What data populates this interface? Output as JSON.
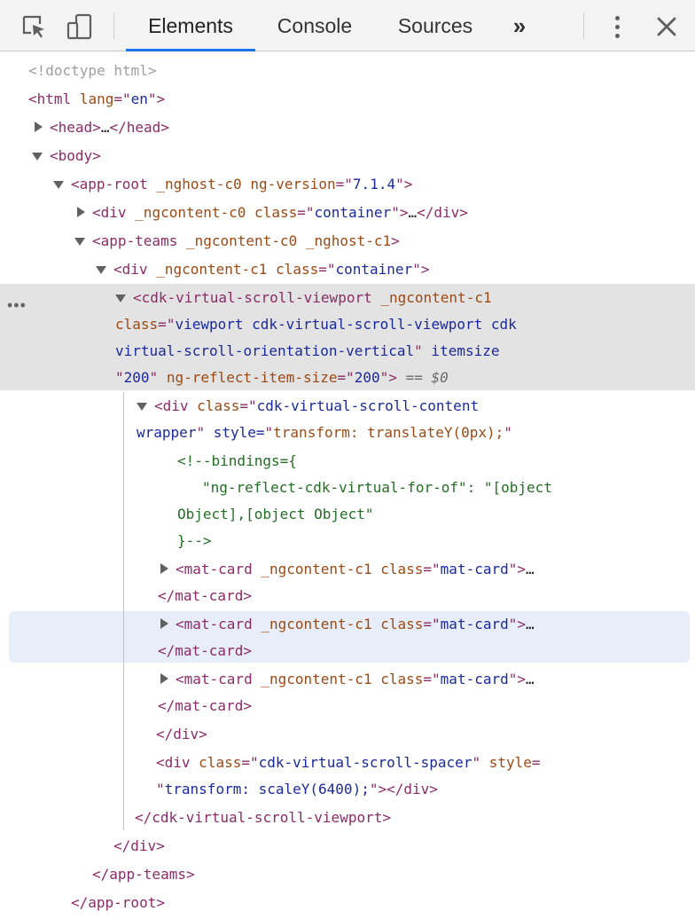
{
  "toolbar": {
    "tabs": [
      "Elements",
      "Console",
      "Sources"
    ],
    "more": "»"
  },
  "tree": {
    "lines": [
      "<!doctype html>",
      "<html lang=\"en\">",
      "<head>…</head>",
      "<body>",
      "<app-root _nghost-c0 ng-version=\"7.1.4\">",
      "<div _ngcontent-c0 class=\"container\">…</div>",
      "<app-teams _ngcontent-c0 _nghost-c1>",
      "<div _ngcontent-c1 class=\"container\">",
      "<cdk-virtual-scroll-viewport _ngcontent-c1",
      "class=\"viewport cdk-virtual-scroll-viewport cdk-",
      "virtual-scroll-orientation-vertical\" itemsize=",
      "\"200\" ng-reflect-item-size=\"200\"> == $0",
      "<div class=\"cdk-virtual-scroll-content-",
      "wrapper\" style=\"transform: translateY(0px);\">",
      "<!--bindings={",
      "\"ng-reflect-cdk-virtual-for-of\": \"[object",
      "Object],[object Object\"",
      "}-->",
      "<mat-card _ngcontent-c1 class=\"mat-card\">…",
      "</mat-card>",
      "<mat-card _ngcontent-c1 class=\"mat-card\">…",
      "</mat-card>",
      "<mat-card _ngcontent-c1 class=\"mat-card\">…",
      "</mat-card>",
      "</div>",
      "<div class=\"cdk-virtual-scroll-spacer\" style=",
      "\"transform: scaleY(6400);\"></div>",
      "</cdk-virtual-scroll-viewport>",
      "</div>",
      "</app-teams>",
      "</app-root>"
    ],
    "selected_index": 8,
    "hovered_index": 20,
    "gutter_dots": "•••"
  },
  "colors": {
    "tag": "#8a2c68",
    "attribute": "#9a4a15",
    "value": "#1a2a9c",
    "comment": "#236e25",
    "doctype": "#9e9e9e",
    "selection": "#e3e3e3",
    "hover": "#e8eef9",
    "accent": "#1a73e8"
  }
}
